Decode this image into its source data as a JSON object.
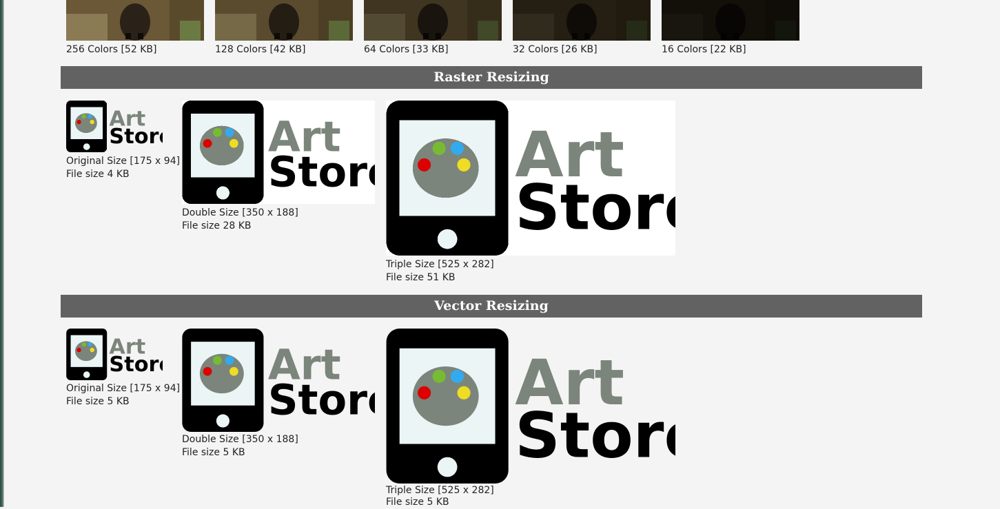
{
  "color_depth": {
    "thumbnails": [
      {
        "label": "256 Colors [52 KB]",
        "brightness": 1.0
      },
      {
        "label": "128 Colors [42 KB]",
        "brightness": 0.85
      },
      {
        "label": "64 Colors [33 KB]",
        "brightness": 0.6
      },
      {
        "label": "32 Colors [26 KB]",
        "brightness": 0.35
      },
      {
        "label": "16 Colors [22 KB]",
        "brightness": 0.18
      }
    ]
  },
  "raster": {
    "heading": "Raster Resizing",
    "items": [
      {
        "size_label": "Original Size [175 x 94]",
        "file_label": "File size 4 KB"
      },
      {
        "size_label": "Double Size [350 x 188]",
        "file_label": "File size 28 KB"
      },
      {
        "size_label": "Triple Size [525 x 282]",
        "file_label": "File size 51 KB"
      }
    ]
  },
  "vector": {
    "heading": "Vector Resizing",
    "items": [
      {
        "size_label": "Original Size [175 x 94]",
        "file_label": "File size 5 KB"
      },
      {
        "size_label": "Double Size [350 x 188]",
        "file_label": "File size 5 KB"
      },
      {
        "size_label": "Triple Size [525 x 282]",
        "file_label": "File size 5 KB"
      }
    ]
  },
  "logo": {
    "word1": "Art",
    "word2": "Store",
    "colors": {
      "gray": "#7b857b",
      "black": "#000000",
      "screen": "#ebf5f6",
      "red": "#dd0000",
      "green": "#77bb33",
      "blue": "#33aaee",
      "yellow": "#eedd22"
    }
  },
  "colors": {
    "page_bg": "#f4f4f4",
    "section_bar": "#626262",
    "section_text": "#ffffff"
  }
}
